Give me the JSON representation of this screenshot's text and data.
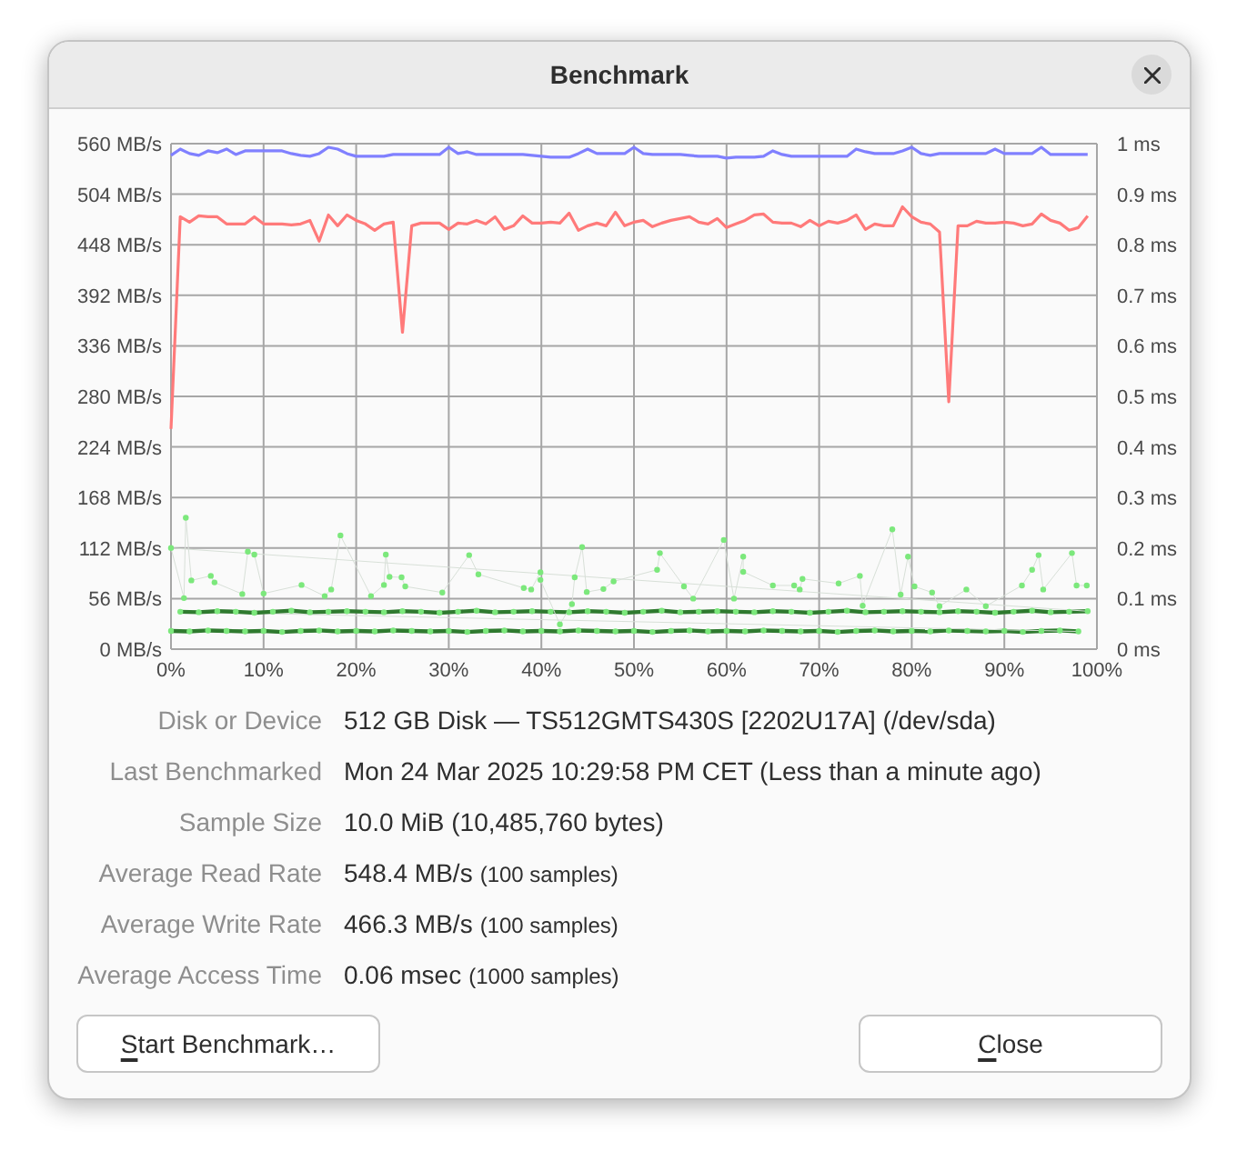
{
  "window": {
    "title": "Benchmark"
  },
  "chart": {
    "rates": {
      "chart_data": {
        "type": "line",
        "grid": true,
        "x": [
          0,
          1,
          2,
          3,
          4,
          5,
          6,
          7,
          8,
          9,
          10,
          11,
          12,
          13,
          14,
          15,
          16,
          17,
          18,
          19,
          20,
          21,
          22,
          23,
          24,
          25,
          26,
          27,
          28,
          29,
          30,
          31,
          32,
          33,
          34,
          35,
          36,
          37,
          38,
          39,
          40,
          41,
          42,
          43,
          44,
          45,
          46,
          47,
          48,
          49,
          50,
          51,
          52,
          53,
          54,
          55,
          56,
          57,
          58,
          59,
          60,
          61,
          62,
          63,
          64,
          65,
          66,
          67,
          68,
          69,
          70,
          71,
          72,
          73,
          74,
          75,
          76,
          77,
          78,
          79,
          80,
          81,
          82,
          83,
          84,
          85,
          86,
          87,
          88,
          89,
          90,
          91,
          92,
          93,
          94,
          95,
          96,
          97,
          98,
          99
        ],
        "series": [
          {
            "color": "#8080ff",
            "values": [
              547,
              554,
              549,
              547,
              552,
              550,
              554,
              548,
              552,
              552,
              552,
              552,
              552,
              549,
              547,
              546,
              549,
              556,
              554,
              549,
              546,
              546,
              546,
              546,
              548,
              548,
              548,
              548,
              548,
              548,
              556,
              549,
              551,
              548,
              548,
              548,
              548,
              548,
              548,
              547,
              546,
              545,
              545,
              545,
              549,
              554,
              549,
              549,
              549,
              549,
              556,
              549,
              548,
              548,
              548,
              548,
              547,
              546,
              546,
              546,
              544,
              545,
              545,
              545,
              546,
              552,
              548,
              546,
              546,
              546,
              546,
              546,
              546,
              546,
              554,
              551,
              549,
              549,
              549,
              552,
              556,
              549,
              547,
              549,
              549,
              549,
              549,
              549,
              549,
              554,
              549,
              549,
              549,
              549,
              556,
              548,
              548,
              548,
              548,
              548
            ]
          },
          {
            "color": "#ff7a7a",
            "values": [
              244,
              479,
              473,
              480,
              479,
              479,
              471,
              471,
              471,
              479,
              471,
              471,
              471,
              470,
              471,
              475,
              452,
              481,
              469,
              481,
              475,
              471,
              464,
              471,
              473,
              351,
              469,
              472,
              472,
              472,
              465,
              472,
              471,
              475,
              471,
              479,
              465,
              469,
              480,
              472,
              472,
              473,
              472,
              483,
              464,
              469,
              472,
              469,
              484,
              469,
              473,
              475,
              468,
              472,
              475,
              477,
              479,
              473,
              471,
              477,
              467,
              471,
              475,
              481,
              482,
              473,
              472,
              472,
              468,
              475,
              469,
              474,
              472,
              475,
              481,
              465,
              471,
              469,
              469,
              490,
              479,
              473,
              471,
              462,
              274,
              469,
              469,
              474,
              472,
              472,
              473,
              472,
              469,
              471,
              482,
              475,
              472,
              464,
              467,
              480
            ]
          }
        ],
        "xlim": [
          0,
          100
        ],
        "ylim": [
          0,
          560
        ],
        "xticks": [
          {
            "value": 0,
            "label": "0%"
          },
          {
            "value": 10,
            "label": "10%"
          },
          {
            "value": 20,
            "label": "20%"
          },
          {
            "value": 30,
            "label": "30%"
          },
          {
            "value": 40,
            "label": "40%"
          },
          {
            "value": 50,
            "label": "50%"
          },
          {
            "value": 60,
            "label": "60%"
          },
          {
            "value": 70,
            "label": "70%"
          },
          {
            "value": 80,
            "label": "80%"
          },
          {
            "value": 90,
            "label": "90%"
          },
          {
            "value": 100,
            "label": "100%"
          }
        ],
        "yticks": [
          {
            "value": 0,
            "label": "0 MB/s"
          },
          {
            "value": 56,
            "label": "56 MB/s"
          },
          {
            "value": 112,
            "label": "112 MB/s"
          },
          {
            "value": 168,
            "label": "168 MB/s"
          },
          {
            "value": 224,
            "label": "224 MB/s"
          },
          {
            "value": 280,
            "label": "280 MB/s"
          },
          {
            "value": 336,
            "label": "336 MB/s"
          },
          {
            "value": 392,
            "label": "392 MB/s"
          },
          {
            "value": 448,
            "label": "448 MB/s"
          },
          {
            "value": 504,
            "label": "504 MB/s"
          },
          {
            "value": 560,
            "label": "560 MB/s"
          }
        ]
      }
    },
    "access_time": {
      "chart_data": {
        "type": "scatter",
        "x": [
          0,
          2,
          4,
          6,
          8,
          10,
          12,
          14,
          16,
          18,
          20,
          22,
          24,
          26,
          28,
          30,
          32,
          34,
          36,
          38,
          40,
          42,
          44,
          46,
          48,
          50,
          52,
          54,
          56,
          58,
          60,
          62,
          64,
          66,
          68,
          70,
          72,
          74,
          76,
          78,
          80,
          82,
          84,
          86,
          88,
          90,
          92,
          94,
          96,
          98,
          1,
          3,
          5,
          7,
          9,
          11,
          13,
          15,
          17,
          19,
          21,
          23,
          25,
          27,
          29,
          31,
          33,
          35,
          37,
          39,
          41,
          43,
          45,
          47,
          49,
          51,
          53,
          55,
          57,
          59,
          61,
          63,
          65,
          67,
          69,
          71,
          73,
          75,
          77,
          79,
          81,
          83,
          85,
          87,
          89,
          91,
          93,
          95,
          97,
          99,
          0,
          1.4,
          1.6,
          2.2,
          4.3,
          4.7,
          7.7,
          8.3,
          9,
          10,
          14.1,
          16.6,
          17.3,
          18.3,
          21.6,
          23,
          23.2,
          23.6,
          24.9,
          25.3,
          29.3,
          32.2,
          33.2,
          38.1,
          38.9,
          39.9,
          39.9,
          42,
          43.3,
          43.6,
          44.4,
          44.9,
          46.7,
          47.8,
          52.5,
          52.8,
          55.4,
          56.4,
          59.7,
          60.8,
          61.8,
          61.8,
          65,
          67.3,
          67.9,
          68.2,
          72.1,
          74.4,
          74.7,
          77.9,
          78.8,
          79.6,
          80.3,
          82.2,
          83,
          85.9,
          88,
          91.9,
          93,
          93.7,
          94.2,
          97.3,
          97.8,
          98.9
        ],
        "series": [
          {
            "color": "#7ce87c",
            "values": [
              0.036,
              0.035,
              0.037,
              0.036,
              0.035,
              0.036,
              0.034,
              0.036,
              0.037,
              0.035,
              0.036,
              0.035,
              0.037,
              0.036,
              0.035,
              0.036,
              0.034,
              0.036,
              0.037,
              0.035,
              0.036,
              0.035,
              0.037,
              0.036,
              0.035,
              0.036,
              0.034,
              0.036,
              0.037,
              0.035,
              0.036,
              0.035,
              0.037,
              0.036,
              0.035,
              0.036,
              0.034,
              0.036,
              0.037,
              0.035,
              0.036,
              0.035,
              0.037,
              0.036,
              0.035,
              0.036,
              0.034,
              0.036,
              0.037,
              0.035,
              0.074,
              0.073,
              0.075,
              0.074,
              0.072,
              0.074,
              0.076,
              0.073,
              0.074,
              0.075,
              0.074,
              0.073,
              0.075,
              0.074,
              0.072,
              0.074,
              0.076,
              0.073,
              0.074,
              0.075,
              0.074,
              0.073,
              0.075,
              0.074,
              0.072,
              0.074,
              0.076,
              0.073,
              0.074,
              0.075,
              0.074,
              0.073,
              0.075,
              0.074,
              0.072,
              0.074,
              0.076,
              0.073,
              0.074,
              0.075,
              0.074,
              0.073,
              0.075,
              0.074,
              0.072,
              0.074,
              0.076,
              0.073,
              0.074,
              0.075,
              0.2,
              0.101,
              0.26,
              0.136,
              0.145,
              0.132,
              0.109,
              0.193,
              0.187,
              0.11,
              0.127,
              0.105,
              0.118,
              0.225,
              0.105,
              0.127,
              0.187,
              0.143,
              0.142,
              0.124,
              0.112,
              0.186,
              0.148,
              0.121,
              0.118,
              0.152,
              0.137,
              0.049,
              0.089,
              0.142,
              0.202,
              0.113,
              0.119,
              0.134,
              0.157,
              0.19,
              0.124,
              0.1,
              0.216,
              0.1,
              0.183,
              0.153,
              0.126,
              0.126,
              0.118,
              0.139,
              0.13,
              0.145,
              0.086,
              0.237,
              0.108,
              0.183,
              0.124,
              0.112,
              0.085,
              0.118,
              0.085,
              0.126,
              0.157,
              0.186,
              0.118,
              0.19,
              0.126,
              0.126
            ]
          }
        ],
        "xlim": [
          0,
          100
        ],
        "ylim": [
          0,
          1
        ],
        "yticks": [
          {
            "value": 0,
            "label": "0 ms"
          },
          {
            "value": 0.1,
            "label": "0.1 ms"
          },
          {
            "value": 0.2,
            "label": "0.2 ms"
          },
          {
            "value": 0.3,
            "label": "0.3 ms"
          },
          {
            "value": 0.4,
            "label": "0.4 ms"
          },
          {
            "value": 0.5,
            "label": "0.5 ms"
          },
          {
            "value": 0.6,
            "label": "0.6 ms"
          },
          {
            "value": 0.7,
            "label": "0.7 ms"
          },
          {
            "value": 0.8,
            "label": "0.8 ms"
          },
          {
            "value": 0.9,
            "label": "0.9 ms"
          },
          {
            "value": 1,
            "label": "1 ms"
          }
        ]
      }
    }
  },
  "details": [
    {
      "label": "Disk or Device",
      "value": "512 GB Disk — TS512GMTS430S [2202U17A] (/dev/sda)"
    },
    {
      "label": "Last Benchmarked",
      "value": "Mon 24 Mar 2025 10:29:58 PM CET (Less than a minute ago)"
    },
    {
      "label": "Sample Size",
      "value": "10.0 MiB (10,485,760 bytes)"
    },
    {
      "label": "Average Read Rate",
      "value": "548.4 MB/s",
      "note": "(100 samples)"
    },
    {
      "label": "Average Write Rate",
      "value": "466.3 MB/s",
      "note": "(100 samples)"
    },
    {
      "label": "Average Access Time",
      "value": "0.06 msec",
      "note": "(1000 samples)"
    }
  ],
  "buttons": [
    {
      "label": "Start Benchmark…",
      "mnemonic_underlined": true
    },
    {
      "label": "Close",
      "mnemonic_underlined": true
    }
  ]
}
